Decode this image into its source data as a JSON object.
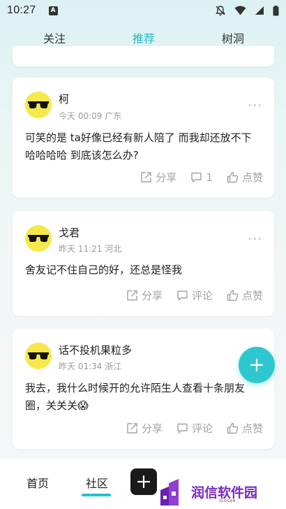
{
  "status_bar": {
    "time": "10:27",
    "app_badge": "A"
  },
  "top_tabs": [
    {
      "label": "关注",
      "active": false
    },
    {
      "label": "推荐",
      "active": true
    },
    {
      "label": "树洞",
      "active": false
    }
  ],
  "posts": [
    {
      "author": "柯",
      "meta": "今天 00:09 广东",
      "more": "···",
      "content": "可笑的是 ta好像已经有新人陪了 而我却还放不下哈哈哈哈 到底该怎么办?",
      "share_label": "分享",
      "comment_label": "1",
      "like_label": "点赞"
    },
    {
      "author": "戈君",
      "meta": "昨天 11:21 河北",
      "more": "···",
      "content": "舍友记不住自己的好，还总是怪我",
      "share_label": "分享",
      "comment_label": "评论",
      "like_label": "点赞"
    },
    {
      "author": "话不投机果粒多",
      "meta": "昨天 01:34 浙江",
      "more": "",
      "content": "我去，我什么时候开的允许陌生人查看十条朋友圈，关关关😱",
      "share_label": "分享",
      "comment_label": "评论",
      "like_label": "点赞"
    }
  ],
  "bottom_nav": [
    {
      "label": "首页",
      "active": false
    },
    {
      "label": "社区",
      "active": true
    }
  ],
  "watermark": {
    "text": "润信软件园",
    "sub": "SLOGAN"
  },
  "colors": {
    "accent": "#22c3cf",
    "fab": "#2fc7cf",
    "avatar_bg": "#f6e84a",
    "watermark": "#7a2bbd"
  }
}
